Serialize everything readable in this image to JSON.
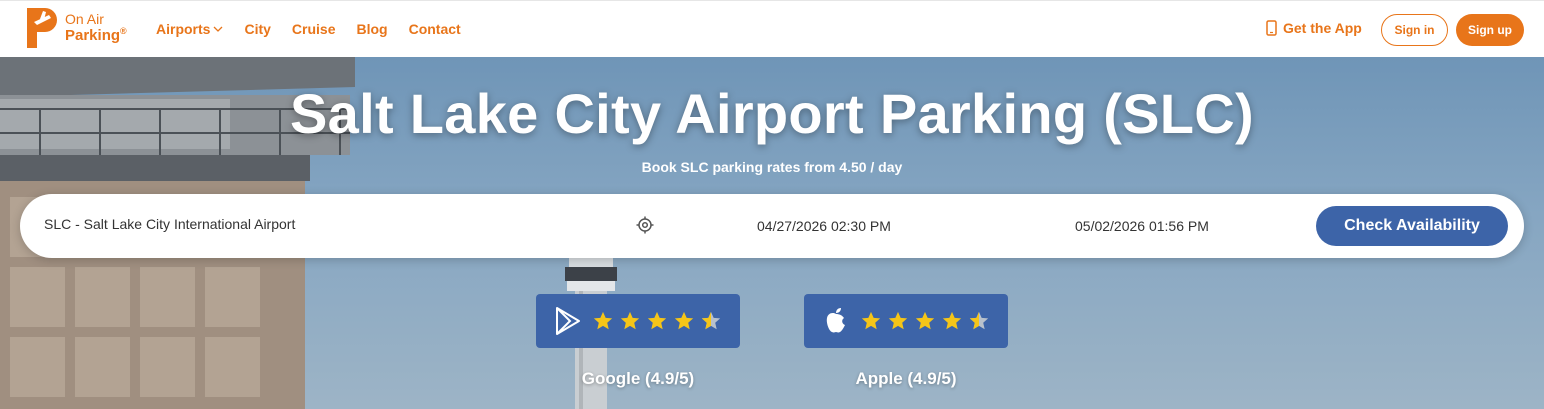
{
  "brand": {
    "line1": "On Air",
    "line2": "Parking",
    "reg": "®",
    "color": "#e8751a"
  },
  "nav": {
    "items": [
      {
        "label": "Airports",
        "has_dropdown": true
      },
      {
        "label": "City"
      },
      {
        "label": "Cruise"
      },
      {
        "label": "Blog"
      },
      {
        "label": "Contact"
      }
    ],
    "get_app": "Get the App",
    "sign_in": "Sign in",
    "sign_up": "Sign up"
  },
  "hero": {
    "title": "Salt Lake City Airport Parking (SLC)",
    "subtitle": "Book SLC parking rates from 4.50 / day"
  },
  "search": {
    "location_value": "SLC - Salt Lake City International Airport",
    "start_datetime": "04/27/2026 02:30 PM",
    "end_datetime": "05/02/2026 01:56 PM",
    "submit_label": "Check Availability",
    "button_color": "#3d64a8"
  },
  "ratings": [
    {
      "store": "Google",
      "icon": "google-play-icon",
      "label": "Google (4.9/5)",
      "stars": 4.9
    },
    {
      "store": "Apple",
      "icon": "apple-icon",
      "label": "Apple (4.9/5)",
      "stars": 4.9
    }
  ]
}
